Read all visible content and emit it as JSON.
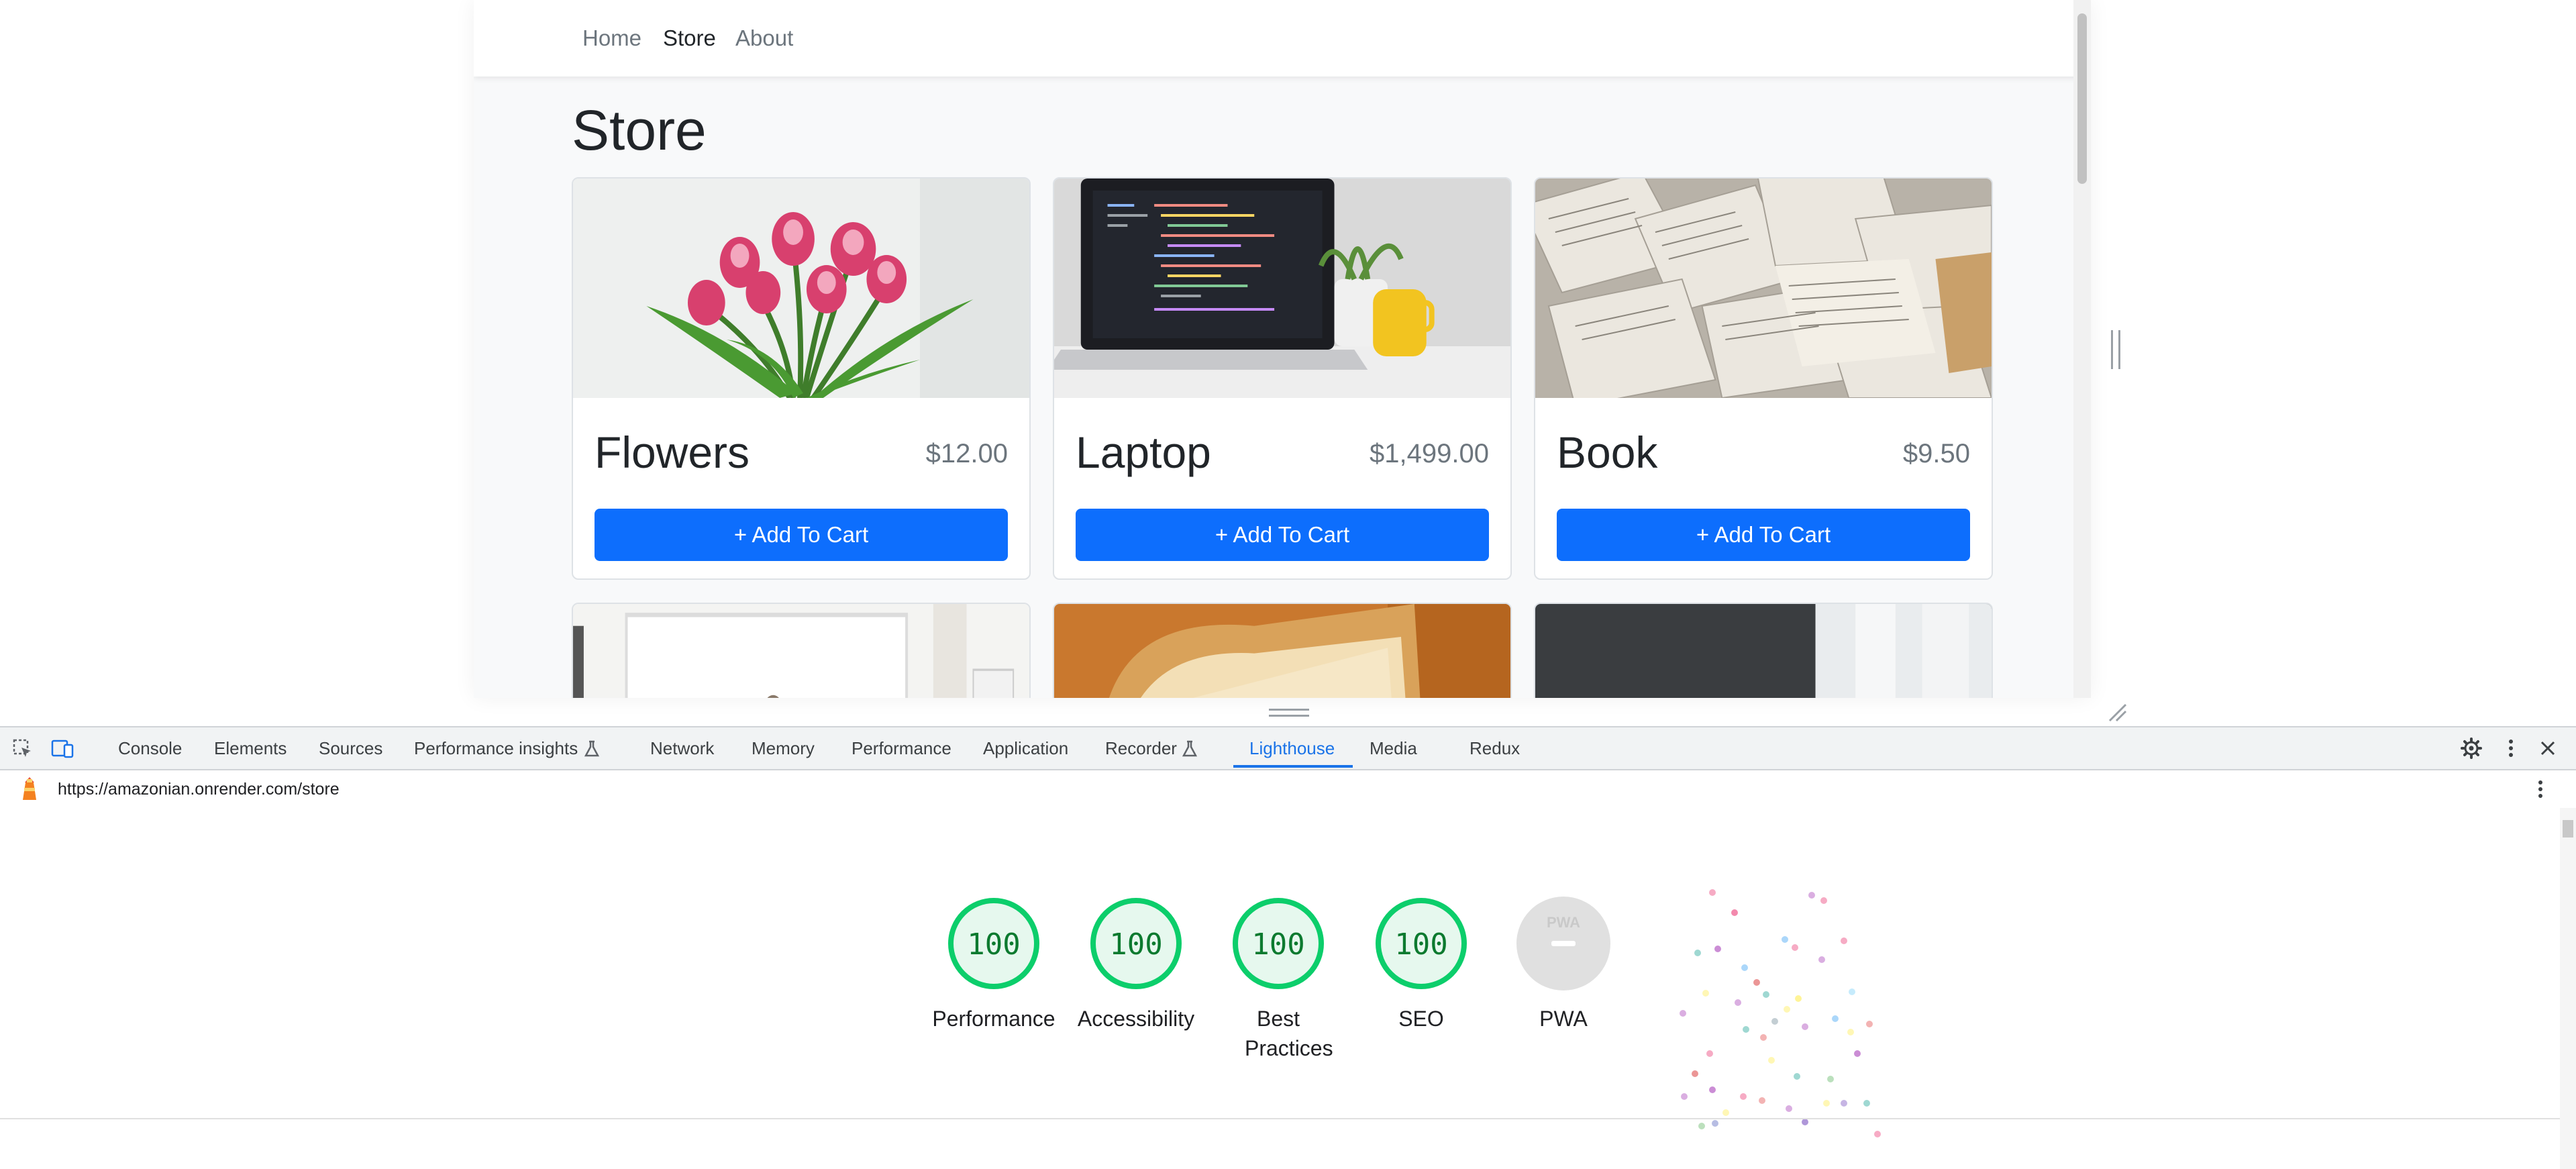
{
  "nav": {
    "items": [
      {
        "label": "Home",
        "active": false
      },
      {
        "label": "Store",
        "active": true
      },
      {
        "label": "About",
        "active": false
      }
    ]
  },
  "page": {
    "title": "Store"
  },
  "products": [
    {
      "name": "Flowers",
      "price": "$12.00",
      "button": "+ Add To Cart",
      "image": "pink-tulips-photo"
    },
    {
      "name": "Laptop",
      "price": "$1,499.00",
      "button": "+ Add To Cart",
      "image": "laptop-code-photo"
    },
    {
      "name": "Book",
      "price": "$9.50",
      "button": "+ Add To Cart",
      "image": "open-books-photo"
    }
  ],
  "partial_row_images": [
    "living-room-photo",
    "bread-slices-photo",
    "white-vases-photo"
  ],
  "devtools": {
    "tabs": [
      "Console",
      "Elements",
      "Sources",
      "Performance insights",
      "Network",
      "Memory",
      "Performance",
      "Application",
      "Recorder",
      "Lighthouse",
      "Media",
      "Redux"
    ],
    "active_tab": "Lighthouse",
    "url": "https://amazonian.onrender.com/store",
    "scores": [
      {
        "label": "Performance",
        "score": "100"
      },
      {
        "label": "Accessibility",
        "score": "100"
      },
      {
        "label": "Best Practices",
        "score": "100"
      },
      {
        "label": "SEO",
        "score": "100"
      },
      {
        "label": "PWA",
        "score": ""
      }
    ],
    "pwa_badge": "PWA"
  },
  "colors": {
    "primary_button": "#0d6efd",
    "score_pass": "#0cce6b",
    "score_pass_text": "#0c7a2f",
    "active_tab": "#1a73e8"
  }
}
